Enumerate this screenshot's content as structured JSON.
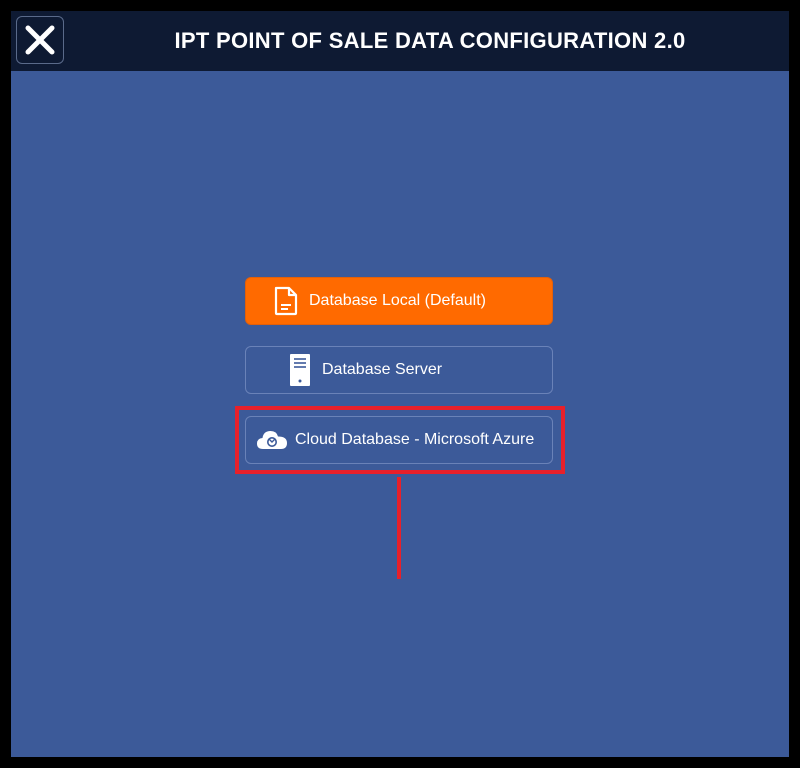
{
  "header": {
    "title": "IPT POINT OF SALE DATA CONFIGURATION 2.0",
    "close_icon": "close-icon"
  },
  "options": [
    {
      "label": "Database Local (Default)",
      "icon": "document-icon",
      "selected": true
    },
    {
      "label": "Database Server",
      "icon": "server-icon",
      "selected": false
    },
    {
      "label": "Cloud Database - Microsoft Azure",
      "icon": "cloud-icon",
      "selected": false
    }
  ],
  "colors": {
    "background": "#3c5a99",
    "titlebar": "#0e1a33",
    "selected": "#ff6a00",
    "highlight": "#e8202a"
  }
}
